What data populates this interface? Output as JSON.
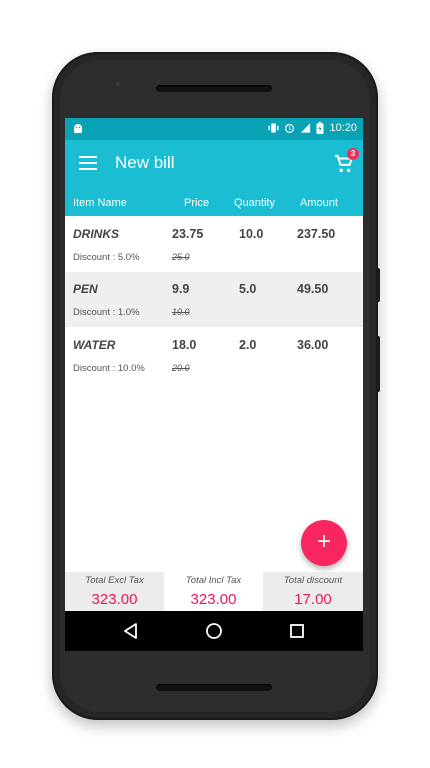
{
  "statusbar": {
    "time": "10:20"
  },
  "toolbar": {
    "title": "New bill",
    "cart_count": "3"
  },
  "table": {
    "headers": {
      "item": "Item Name",
      "price": "Price",
      "quantity": "Quantity",
      "amount": "Amount"
    },
    "rows": [
      {
        "name": "DRINKS",
        "price": "23.75",
        "quantity": "10.0",
        "amount": "237.50",
        "discount": "Discount : 5.0%",
        "original_price": "25.0"
      },
      {
        "name": "PEN",
        "price": "9.9",
        "quantity": "5.0",
        "amount": "49.50",
        "discount": "Discount : 1.0%",
        "original_price": "10.0"
      },
      {
        "name": "WATER",
        "price": "18.0",
        "quantity": "2.0",
        "amount": "36.00",
        "discount": "Discount : 10.0%",
        "original_price": "20.0"
      }
    ]
  },
  "fab": {
    "label": "+"
  },
  "totals": {
    "excl_label": "Total Excl Tax",
    "excl_value": "323.00",
    "incl_label": "Total Incl Tax",
    "incl_value": "323.00",
    "discount_label": "Total discount",
    "discount_value": "17.00"
  },
  "colors": {
    "primary": "#1bbdd3",
    "primary_dark": "#0aa3b6",
    "accent": "#f7265f",
    "total_value": "#e8195b"
  },
  "icons": [
    "android-icon",
    "vibrate-icon",
    "alarm-icon",
    "signal-icon",
    "battery-icon",
    "menu-icon",
    "cart-icon",
    "plus-icon",
    "back-icon",
    "home-icon",
    "recents-icon"
  ]
}
